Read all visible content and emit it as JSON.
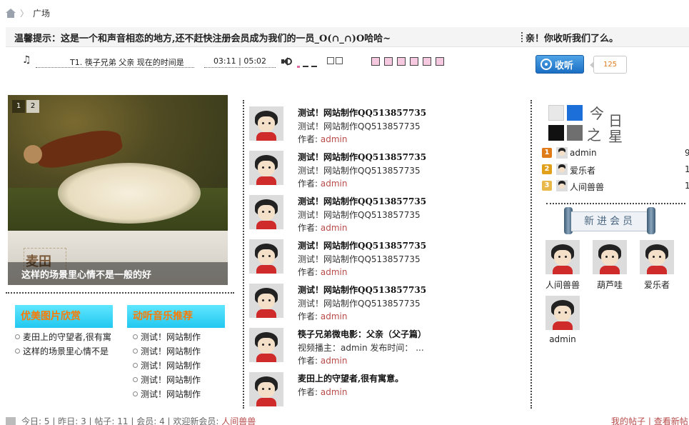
{
  "breadcrumb": {
    "current": "广场",
    "separator": "〉"
  },
  "notice": {
    "text": "温馨提示：这是一个和声音相恋的地方,还不赶快注册会员成为我们的一员_O(∩_∩)O哈哈~",
    "right": "亲！你收听我们了么。"
  },
  "player": {
    "track": "T1. 筷子兄弟  父亲  现在的时间是",
    "time": "03:11 | 05:02",
    "note_icon": "♫"
  },
  "listen": {
    "label": "收听",
    "count": "125"
  },
  "slideshow": {
    "pages": [
      "1",
      "2"
    ],
    "active": 1,
    "caption": "这样的场景里心情不是一般的好",
    "logo_text": "麦田"
  },
  "sections": {
    "pictures": {
      "title": "优美图片欣赏",
      "items": [
        "麦田上的守望者,很有寓",
        "这样的场景里心情不是"
      ]
    },
    "music": {
      "title": "动听音乐推荐",
      "items": [
        "测试！网站制作",
        "测试！网站制作",
        "测试！网站制作",
        "测试！网站制作",
        "测试！网站制作"
      ]
    }
  },
  "posts": [
    {
      "title": "测试！网站制作QQ513857735",
      "desc": "测试！网站制作QQ513857735",
      "author_label": "作者:",
      "author": "admin"
    },
    {
      "title": "测试！网站制作QQ513857735",
      "desc": "测试！网站制作QQ513857735",
      "author_label": "作者:",
      "author": "admin"
    },
    {
      "title": "测试！网站制作QQ513857735",
      "desc": "测试！网站制作QQ513857735",
      "author_label": "作者:",
      "author": "admin"
    },
    {
      "title": "测试！网站制作QQ513857735",
      "desc": "测试！网站制作QQ513857735",
      "author_label": "作者:",
      "author": "admin"
    },
    {
      "title": "测试！网站制作QQ513857735",
      "desc": "测试！网站制作QQ513857735",
      "author_label": "作者:",
      "author": "admin"
    },
    {
      "title": "筷子兄弟微电影：父亲（父子篇）",
      "desc": "视频播主：admin 发布时间： ...",
      "author_label": "作者:",
      "author": "admin"
    },
    {
      "title": "麦田上的守望者,很有寓意。",
      "desc": "",
      "author_label": "作者:",
      "author": "admin"
    }
  ],
  "stars": {
    "title_chars": [
      "今",
      "日",
      "之",
      "星"
    ],
    "rankings": [
      {
        "rank": "1",
        "name": "admin",
        "value": "9",
        "color": "#e07b1a"
      },
      {
        "rank": "2",
        "name": "爱乐者",
        "value": "1",
        "color": "#e0a01a"
      },
      {
        "rank": "3",
        "name": "人间兽兽",
        "value": "1",
        "color": "#e8b84a"
      }
    ]
  },
  "new_members": {
    "title": "新进会员",
    "members": [
      "人间兽兽",
      "葫芦哇",
      "爱乐者",
      "admin"
    ]
  },
  "footer": {
    "today_label": "今日:",
    "today": "5",
    "yesterday_label": "昨日:",
    "yesterday": "3",
    "posts_label": "帖子:",
    "posts": "11",
    "members_label": "会员:",
    "members": "4",
    "welcome_label": "欢迎新会员:",
    "welcome_user": "人间兽兽",
    "my_posts": "我的帖子",
    "view_new": "查看新帖"
  },
  "colors": {
    "accent_blue": "#1b6fc4",
    "section_head": "#22c8f0",
    "section_text": "#ff7a00",
    "author_link": "#b84a4a"
  }
}
